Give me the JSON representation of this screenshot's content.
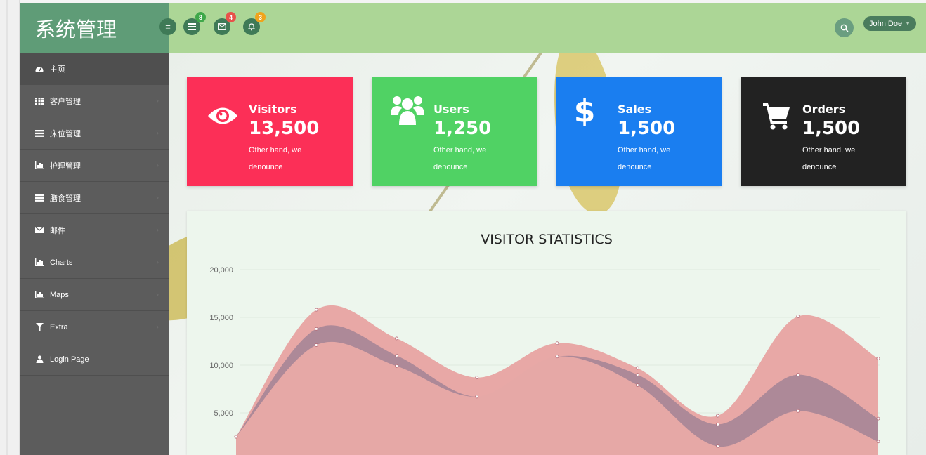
{
  "header": {
    "brand": "系统管理",
    "badges": {
      "tasks": "8",
      "messages": "4",
      "alerts": "3"
    },
    "user": "John Doe"
  },
  "sidebar": {
    "items": [
      {
        "label": "主页",
        "icon": "dashboard-icon",
        "active": true
      },
      {
        "label": "客户管理",
        "icon": "grid-icon"
      },
      {
        "label": "床位管理",
        "icon": "list-icon"
      },
      {
        "label": "护理管理",
        "icon": "bar-chart-icon"
      },
      {
        "label": "膳食管理",
        "icon": "list-icon"
      },
      {
        "label": "邮件",
        "icon": "envelope-icon"
      },
      {
        "label": "Charts",
        "icon": "bar-chart-icon"
      },
      {
        "label": "Maps",
        "icon": "bar-chart-icon"
      },
      {
        "label": "Extra",
        "icon": "filter-icon"
      },
      {
        "label": "Login Page",
        "icon": "user-icon"
      }
    ]
  },
  "cards": [
    {
      "title": "Visitors",
      "value": "13,500",
      "desc": "Other hand, we denounce",
      "color": "#fc2f57",
      "icon": "eye-icon"
    },
    {
      "title": "Users",
      "value": "1,250",
      "desc": "Other hand, we denounce",
      "color": "#50d264",
      "icon": "users-icon"
    },
    {
      "title": "Sales",
      "value": "1,500",
      "desc": "Other hand, we denounce",
      "color": "#1a7ef0",
      "icon": "dollar-icon"
    },
    {
      "title": "Orders",
      "value": "1,500",
      "desc": "Other hand, we denounce",
      "color": "#222222",
      "icon": "cart-icon"
    }
  ],
  "chart_data": {
    "type": "area",
    "title": "VISITOR STATISTICS",
    "ylim": [
      0,
      20000
    ],
    "yticks": [
      "5,000",
      "10,000",
      "15,000",
      "20,000"
    ],
    "ytick_values": [
      5000,
      10000,
      15000,
      20000
    ],
    "x": [
      0,
      1,
      2,
      3,
      4,
      5,
      6,
      7,
      8
    ],
    "series": [
      {
        "values": [
          2500,
          15800,
          12800,
          8700,
          12300,
          9700,
          4700,
          15100,
          10700
        ],
        "color": "#e8a8a6"
      },
      {
        "values": [
          2500,
          13800,
          11000,
          6700,
          10900,
          9000,
          3800,
          9000,
          4400
        ],
        "color": "#aa8797"
      },
      {
        "values": [
          2500,
          12100,
          9900,
          6700,
          10900,
          7900,
          1500,
          5200,
          2000
        ],
        "color": "#e6a8a6"
      }
    ]
  }
}
